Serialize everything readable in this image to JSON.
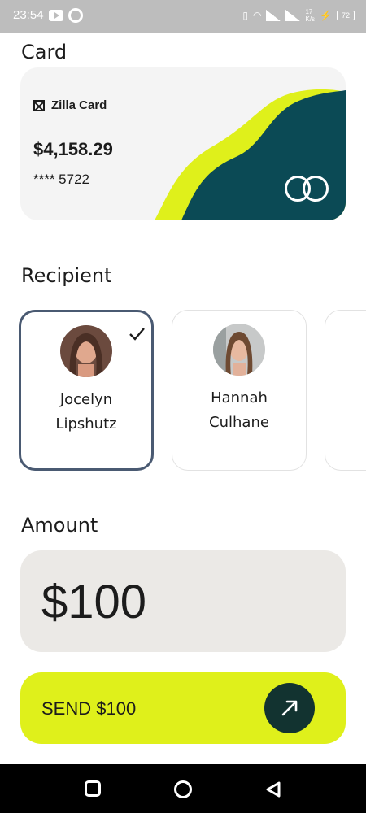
{
  "status_bar": {
    "time": "23:54",
    "network_speed": "17\nK/s",
    "battery": "72"
  },
  "sections": {
    "card_title": "Card",
    "recipient_title": "Recipient",
    "amount_title": "Amount"
  },
  "card": {
    "brand": "Zilla Card",
    "balance": "$4,158.29",
    "number": "**** 5722",
    "colors": {
      "wave_yellow": "#dff01b",
      "wave_teal": "#0b4a55"
    }
  },
  "recipients": [
    {
      "name": "Jocelyn Lipshutz",
      "first": "Jocelyn",
      "last": "Lipshutz",
      "selected": true
    },
    {
      "name": "Hannah Culhane",
      "first": "Hannah",
      "last": "Culhane",
      "selected": false
    }
  ],
  "amount": {
    "value": "$100"
  },
  "send_button": {
    "label": "SEND $100",
    "icon": "arrow-up-right-icon"
  },
  "nav_bar": {
    "icons": [
      "recent-apps-icon",
      "home-icon",
      "back-icon"
    ]
  },
  "colors": {
    "accent": "#dff01b",
    "dark": "#123330",
    "selected_border": "#4a5a72"
  }
}
